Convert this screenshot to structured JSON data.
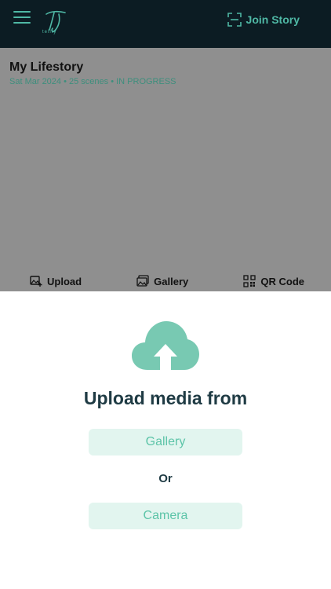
{
  "header": {
    "logo_text": "TJ",
    "logo_subtext": "tellty",
    "join_label": "Join Story"
  },
  "story": {
    "title": "My Lifestory",
    "meta": "Sat Mar 2024 • 25 scenes • IN PROGRESS"
  },
  "tabs": [
    {
      "label": "Upload",
      "icon": "image-plus-icon"
    },
    {
      "label": "Gallery",
      "icon": "gallery-icon"
    },
    {
      "label": "QR Code",
      "icon": "qr-code-icon"
    }
  ],
  "upload_sheet": {
    "title": "Upload media from",
    "gallery_label": "Gallery",
    "or_label": "Or",
    "camera_label": "Camera",
    "icon": "cloud-upload-icon"
  },
  "colors": {
    "header_bg": "#0c1c23",
    "accent": "#4fb8a5",
    "overlay": "#8f8f8f",
    "button_bg": "#e2f5ef",
    "button_text": "#5cc4a8",
    "title_text": "#1f3b44"
  }
}
